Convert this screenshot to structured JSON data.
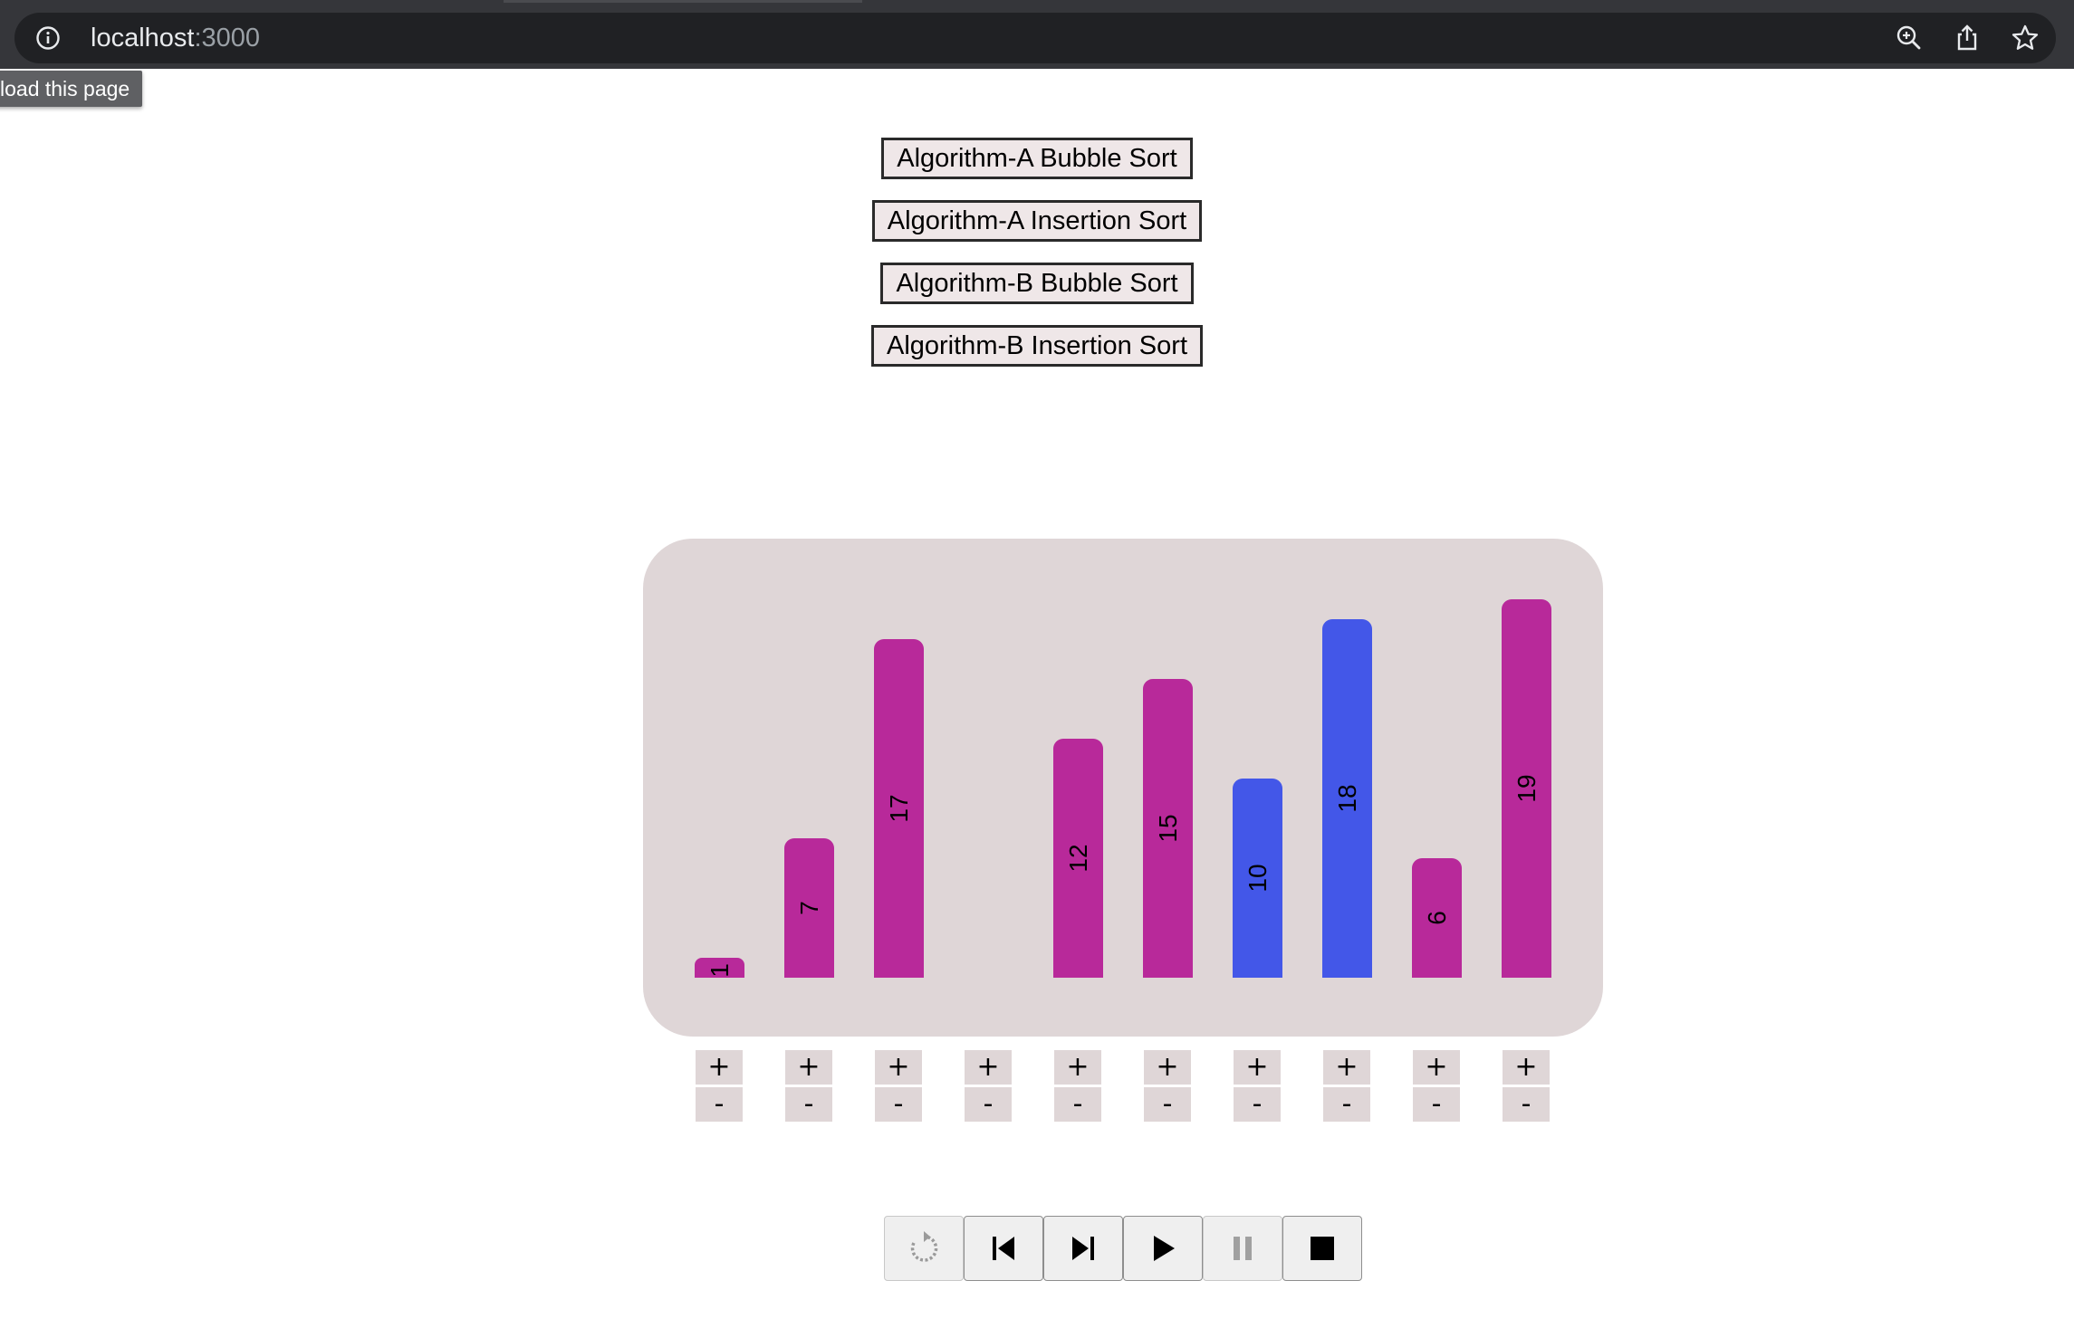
{
  "browser": {
    "url_host": "localhost",
    "url_port": ":3000",
    "tooltip": "load this page"
  },
  "algorithms": [
    {
      "label": "Algorithm-A Bubble Sort"
    },
    {
      "label": "Algorithm-A Insertion Sort"
    },
    {
      "label": "Algorithm-B Bubble Sort"
    },
    {
      "label": "Algorithm-B Insertion Sort"
    }
  ],
  "chart_data": {
    "type": "bar",
    "values": [
      1,
      7,
      17,
      0,
      12,
      15,
      10,
      18,
      6,
      19
    ],
    "labels": [
      "1",
      "7",
      "17",
      "",
      "12",
      "15",
      "10",
      "18",
      "6",
      "19"
    ],
    "highlighted": [
      6,
      7
    ],
    "colors": {
      "default": "#b8299a",
      "highlight": "#4357e8"
    }
  },
  "steppers": {
    "plus_label": "+",
    "minus_label": "-"
  },
  "controls": [
    {
      "icon": "reset-icon",
      "enabled": false
    },
    {
      "icon": "skip-back-icon",
      "enabled": true
    },
    {
      "icon": "skip-forward-icon",
      "enabled": true
    },
    {
      "icon": "play-icon",
      "enabled": true
    },
    {
      "icon": "pause-icon",
      "enabled": false
    },
    {
      "icon": "stop-icon",
      "enabled": true
    }
  ]
}
